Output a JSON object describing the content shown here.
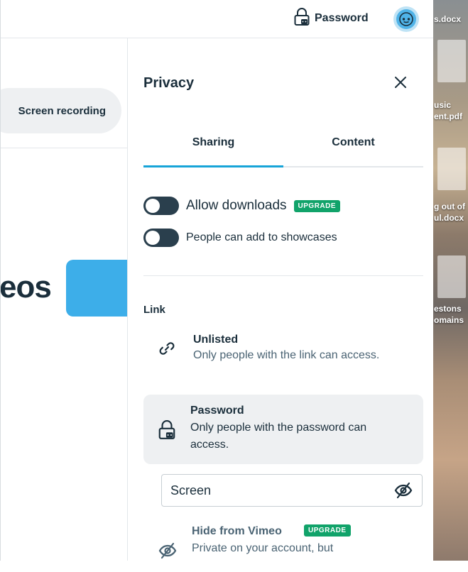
{
  "desktop": {
    "labels": [
      "s.docx",
      "usic",
      "ent.pdf",
      "g out of",
      "ul.docx",
      "estons",
      "omains"
    ]
  },
  "topbar": {
    "password_label": "Password",
    "avatar_icon": "smiley-face-icon"
  },
  "main": {
    "screen_recording_label": "Screen recording",
    "videos_partial_title": "eos"
  },
  "privacy": {
    "title": "Privacy",
    "tabs": [
      {
        "label": "Sharing",
        "active": true
      },
      {
        "label": "Content",
        "active": false
      }
    ],
    "toggles": [
      {
        "label": "Allow downloads",
        "badge": "UPGRADE",
        "on": false
      },
      {
        "label": "People can add to showcases",
        "on": false
      }
    ],
    "link_heading": "Link",
    "options": {
      "unlisted": {
        "title": "Unlisted",
        "description": "Only people with the link can access."
      },
      "password": {
        "title": "Password",
        "description_line1": "Only people with the password can",
        "description_line2": "access.",
        "selected": true
      },
      "hide": {
        "title": "Hide from Vimeo",
        "badge": "UPGRADE",
        "description": "Private on your account, but"
      }
    },
    "password_field": {
      "value": "Screen"
    }
  },
  "colors": {
    "accent": "#17a4d8",
    "upgrade_badge": "#11a36a",
    "text_primary": "#1a2e3b",
    "text_secondary": "#4a6373",
    "toggle_off": "#2a3f4d",
    "selected_bg": "#eef0f2"
  }
}
